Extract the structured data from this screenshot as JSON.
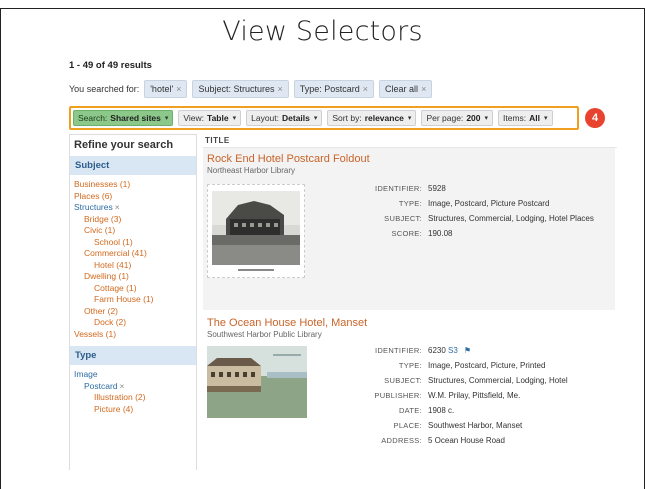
{
  "slide": {
    "title": "View Selectors"
  },
  "results": {
    "count": "1 - 49 of 49 results"
  },
  "searched": {
    "label": "You searched for:",
    "chips": [
      {
        "text": "'hotel'"
      },
      {
        "text": "Subject: Structures"
      },
      {
        "text": "Type: Postcard"
      },
      {
        "text": "Clear all"
      }
    ],
    "remove_glyph": "×"
  },
  "selectors": [
    {
      "prefix": "Search:",
      "value": "Shared sites"
    },
    {
      "prefix": "View:",
      "value": "Table"
    },
    {
      "prefix": "Layout:",
      "value": "Details"
    },
    {
      "prefix": "Sort by:",
      "value": "relevance"
    },
    {
      "prefix": "Per page:",
      "value": "200"
    },
    {
      "prefix": "Items:",
      "value": "All"
    }
  ],
  "caret": "▾",
  "badge": "4",
  "sidebar": {
    "title": "Refine your search",
    "subject_head": "Subject",
    "subject_items": [
      {
        "label": "Businesses (1)"
      },
      {
        "label": "Places (6)"
      },
      {
        "label": "Structures"
      },
      {
        "label": "Bridge (3)"
      },
      {
        "label": "Civic (1)"
      },
      {
        "label": "School (1)"
      },
      {
        "label": "Commercial (41)"
      },
      {
        "label": "Hotel (41)"
      },
      {
        "label": "Dwelling (1)"
      },
      {
        "label": "Cottage (1)"
      },
      {
        "label": "Farm House (1)"
      },
      {
        "label": "Other (2)"
      },
      {
        "label": "Dock (2)"
      },
      {
        "label": "Vessels (1)"
      }
    ],
    "type_head": "Type",
    "type_items": [
      {
        "label": "Image"
      },
      {
        "label": "Postcard"
      },
      {
        "label": "Illustration (2)"
      },
      {
        "label": "Picture (4)"
      }
    ]
  },
  "table": {
    "column_title": "Title",
    "results": [
      {
        "title": "Rock End Hotel Postcard Foldout",
        "library": "Northeast Harbor Library",
        "fields": [
          {
            "label": "Identifier:",
            "value": "5928"
          },
          {
            "label": "Type:",
            "value": "Image, Postcard, Picture Postcard"
          },
          {
            "label": "Subject:",
            "value": "Structures, Commercial, Lodging, Hotel Places"
          },
          {
            "label": "Score:",
            "value": "190.08"
          }
        ]
      },
      {
        "title": "The Ocean House Hotel, Manset",
        "library": "Southwest Harbor Public Library",
        "identifier": "6230",
        "s3": "S3",
        "flag": "⚑",
        "fields": [
          {
            "label": "Type:",
            "value": "Image, Postcard, Picture, Printed"
          },
          {
            "label": "Subject:",
            "value": "Structures, Commercial, Lodging, Hotel"
          },
          {
            "label": "Publisher:",
            "value": "W.M. Prilay, Pittsfield, Me."
          },
          {
            "label": "Date:",
            "value": "1908 c."
          },
          {
            "label": "Place:",
            "value": "Southwest Harbor, Manset"
          },
          {
            "label": "Address:",
            "value": "5 Ocean House Road"
          }
        ],
        "identifier_label": "Identifier:"
      }
    ]
  },
  "colors": {
    "accent_orange": "#f0a020",
    "badge_red": "#e8432e",
    "link_orange": "#d2691e",
    "link_blue": "#2d6ca2",
    "facet_head_bg": "#d9e6f3",
    "shared_sites_green": "#8bc88a"
  }
}
